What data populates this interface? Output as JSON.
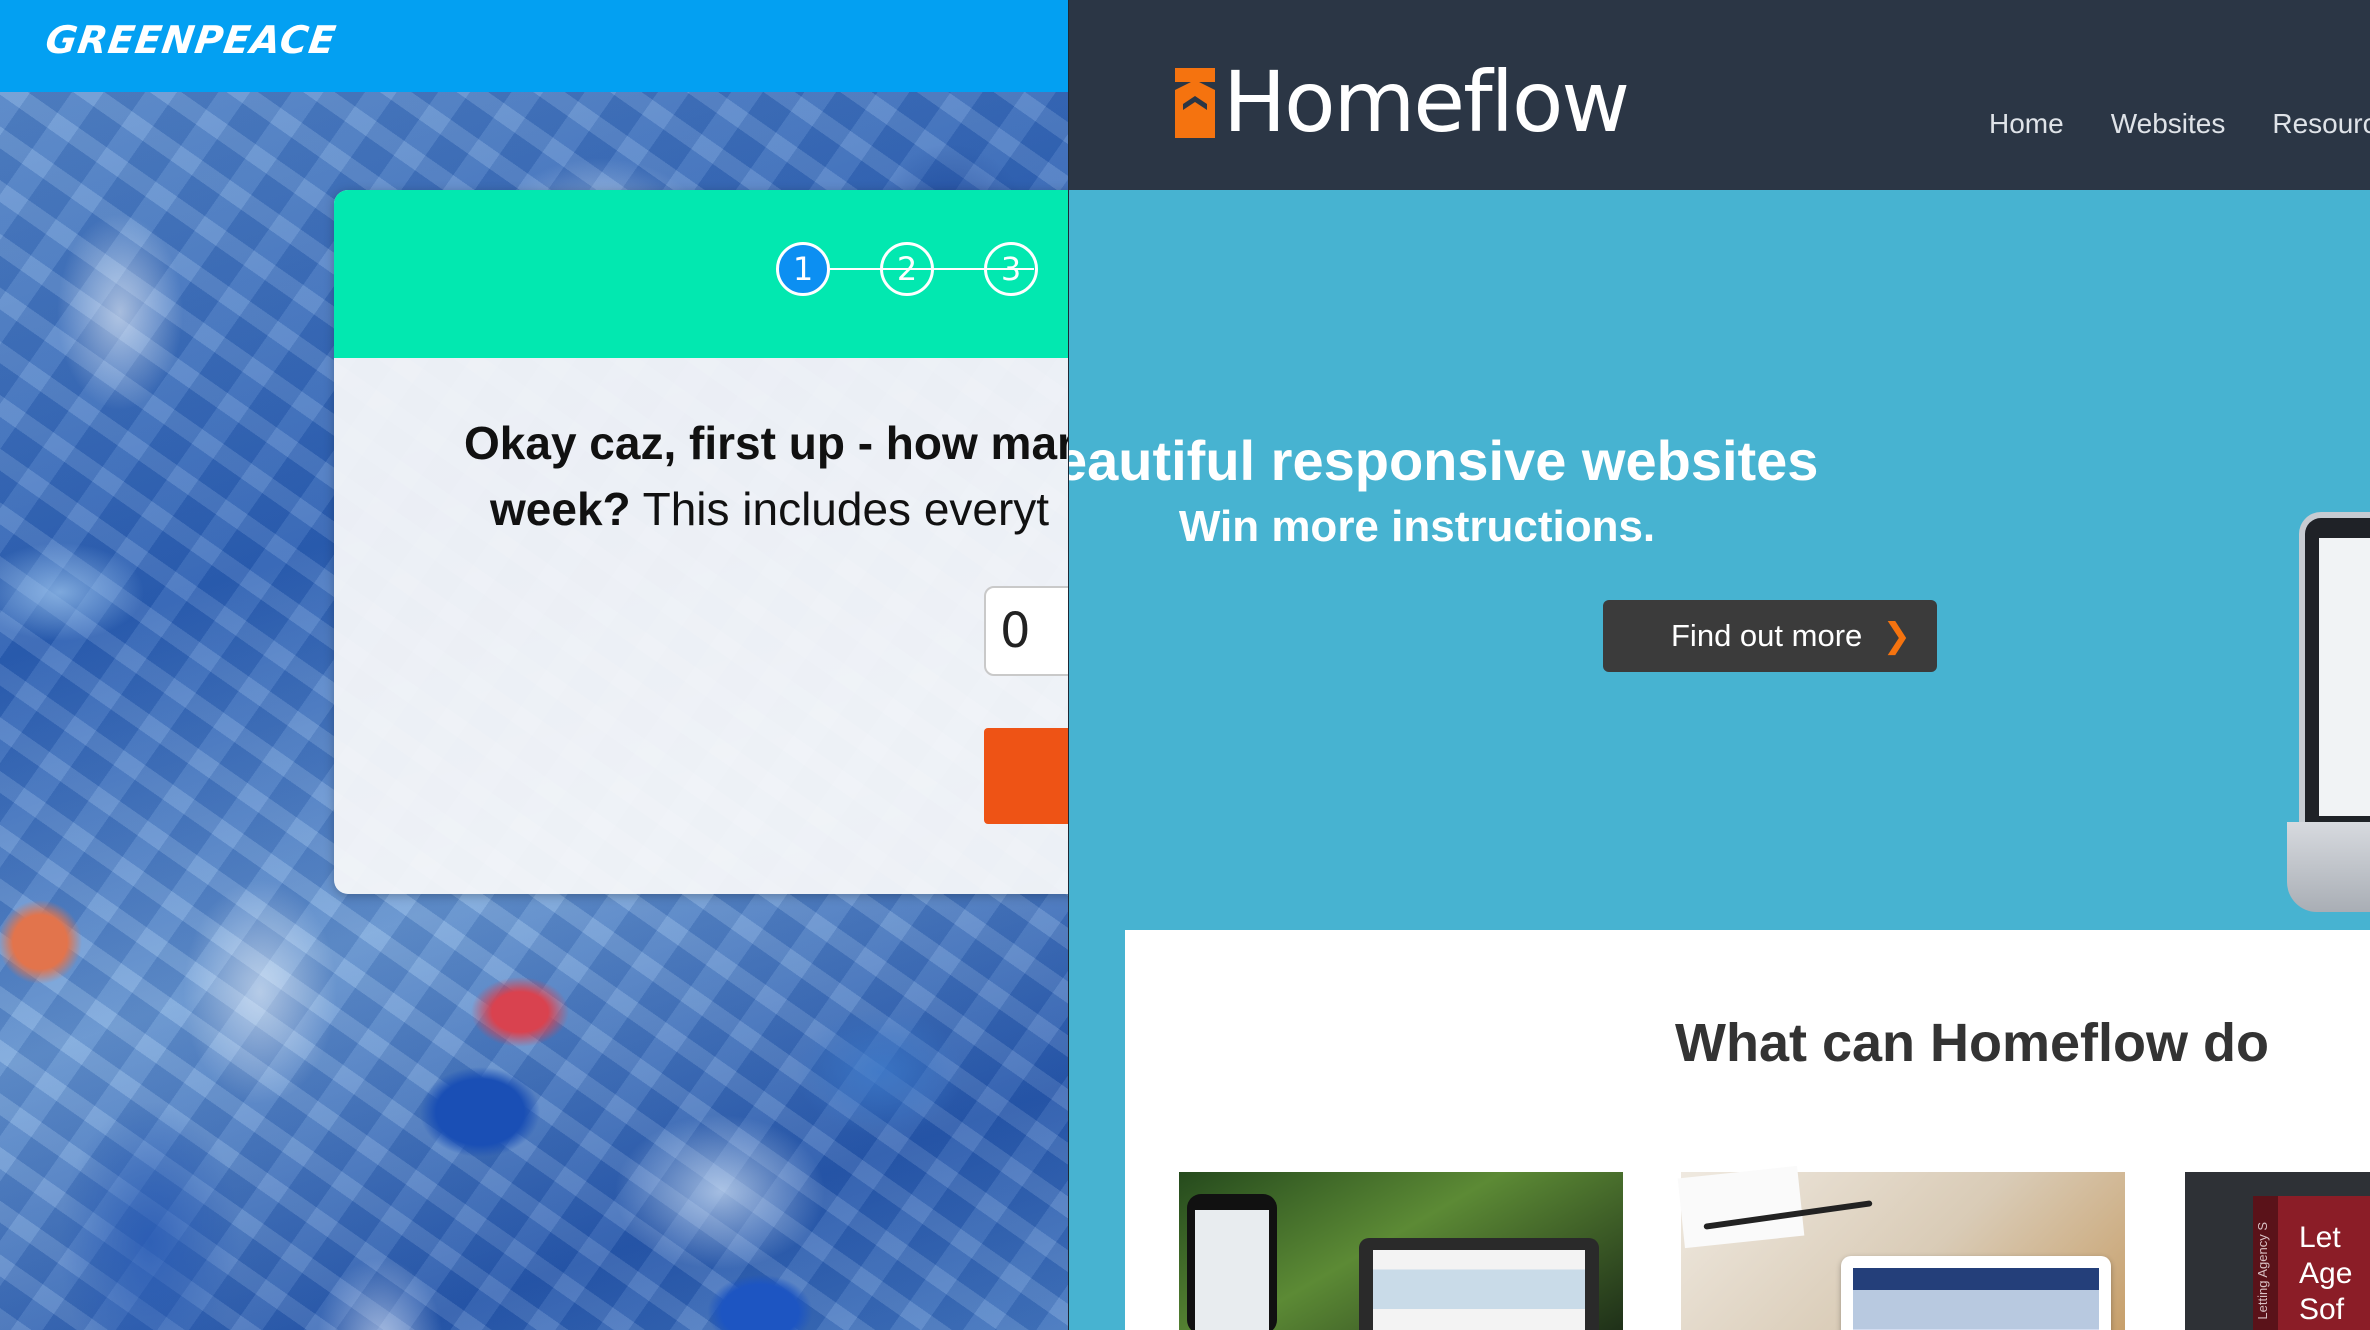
{
  "greenpeace": {
    "logo": "GREENPEACE",
    "steps": [
      "1",
      "2",
      "3"
    ],
    "question_bold_1": "Okay caz, first up - how mar",
    "question_bold_2": "week?",
    "question_rest_2": " This includes everyt",
    "input_value": "0",
    "colors": {
      "header": "#03a0f2",
      "steps_bar": "#02e8b0",
      "active_step": "#0c8ff2",
      "next_button": "#ee5315"
    }
  },
  "homeflow": {
    "logo": "Homeflow",
    "nav": [
      "Home",
      "Websites",
      "Resourc"
    ],
    "hero_title": "Beautiful responsive websites",
    "hero_subtitle": "Win more instructions.",
    "cta_label": "Find out more",
    "section_title": "What can Homeflow do",
    "thumb3_side_text": "Letting Agency S",
    "thumb3_label": "Let\nAge\nSof",
    "colors": {
      "header": "#2b3645",
      "hero": "#47b3d1",
      "logo_icon": "#f5730f",
      "cta": "#3b3b3b"
    }
  }
}
